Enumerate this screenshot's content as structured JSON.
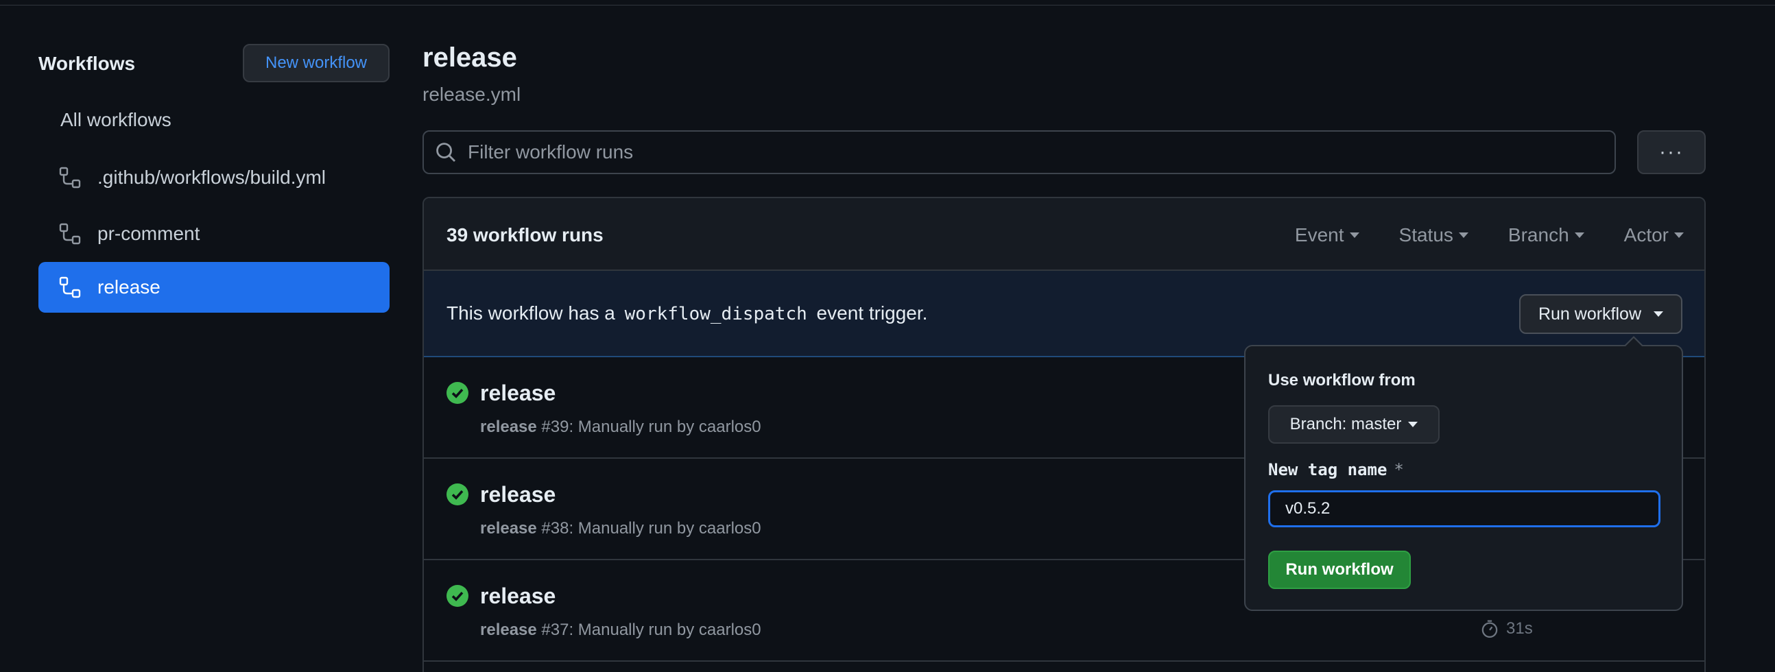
{
  "sidebar": {
    "title": "Workflows",
    "new_workflow_label": "New workflow",
    "all_workflows_label": "All workflows",
    "items": [
      {
        "label": ".github/workflows/build.yml",
        "icon": "workflow-icon",
        "active": false
      },
      {
        "label": "pr-comment",
        "icon": "workflow-icon",
        "active": false
      },
      {
        "label": "release",
        "icon": "workflow-icon",
        "active": true
      }
    ]
  },
  "header": {
    "title": "release",
    "subtitle": "release.yml"
  },
  "filter": {
    "placeholder": "Filter workflow runs",
    "icon": "search-icon",
    "more_label": "···"
  },
  "runs": {
    "count_label": "39 workflow runs",
    "filters": [
      {
        "label": "Event"
      },
      {
        "label": "Status"
      },
      {
        "label": "Branch"
      },
      {
        "label": "Actor"
      }
    ],
    "dispatch": {
      "text_before": "This workflow has a",
      "code": "workflow_dispatch",
      "text_after": "event trigger.",
      "button_label": "Run workflow"
    },
    "items": [
      {
        "title": "release",
        "meta_bold": "release",
        "meta_rest": " #39: Manually run by caarlos0",
        "duration": ""
      },
      {
        "title": "release",
        "meta_bold": "release",
        "meta_rest": " #38: Manually run by caarlos0",
        "duration": ""
      },
      {
        "title": "release",
        "meta_bold": "release",
        "meta_rest": " #37: Manually run by caarlos0",
        "duration": "31s"
      }
    ]
  },
  "popup": {
    "use_from_label": "Use workflow from",
    "branch_label": "Branch: master",
    "tag_label": "New tag name",
    "required_mark": "*",
    "tag_value": "v0.5.2",
    "run_label": "Run workflow"
  },
  "colors": {
    "background": "#0d1117",
    "accent": "#1f6feb",
    "success": "#3fb950",
    "run_button": "#238636"
  }
}
